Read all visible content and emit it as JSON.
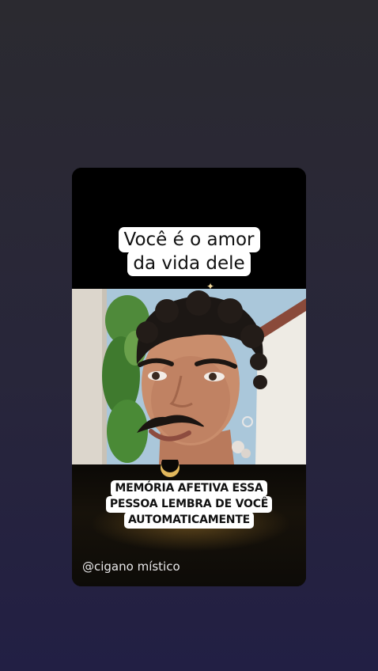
{
  "story": {
    "top_caption": [
      "Você é o amor",
      "da vida dele"
    ],
    "bottom_caption": [
      "MEMÓRIA AFETIVA ESSA",
      "PESSOA LEMBRA DE VOCÊ",
      "AUTOMATICAMENTE"
    ],
    "handle": "@cigano místico"
  },
  "colors": {
    "background_top": "#2b2a30",
    "background_bottom": "#221f44",
    "caption_bg": "#ffffff",
    "caption_text": "#111111",
    "handle_text": "#e8e8ea"
  }
}
